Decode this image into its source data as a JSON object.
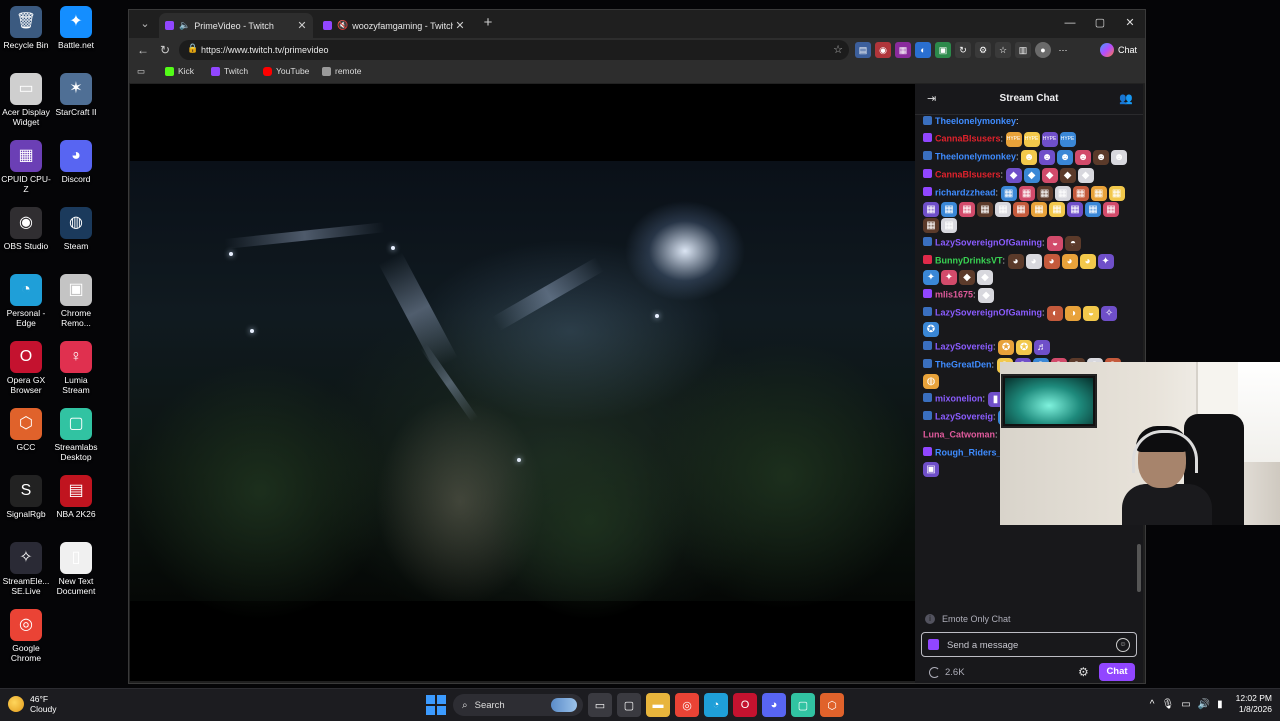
{
  "desktop": {
    "icons": [
      {
        "label": "Recycle Bin",
        "glyph": "🗑",
        "color": "#3b5a80"
      },
      {
        "label": "Battle.net",
        "glyph": "✦",
        "color": "#148eff"
      },
      {
        "label": "Acer Display Widget",
        "glyph": "▭",
        "color": "#cfcfcf"
      },
      {
        "label": "StarCraft II",
        "glyph": "✶",
        "color": "#4f6f95"
      },
      {
        "label": "CPUID CPU-Z",
        "glyph": "▦",
        "color": "#6b3fb5"
      },
      {
        "label": "Discord",
        "glyph": "◕",
        "color": "#5865f2"
      },
      {
        "label": "OBS Studio",
        "glyph": "◉",
        "color": "#302e31"
      },
      {
        "label": "Steam",
        "glyph": "◍",
        "color": "#1b3a5c"
      },
      {
        "label": "Personal - Edge",
        "glyph": "◔",
        "color": "#1f9fd8"
      },
      {
        "label": "Chrome Remo...",
        "glyph": "▣",
        "color": "#c4c4c4"
      },
      {
        "label": "Opera GX Browser",
        "glyph": "O",
        "color": "#c4122f"
      },
      {
        "label": "Lumia Stream",
        "glyph": "♀",
        "color": "#e0304f"
      },
      {
        "label": "GCC",
        "glyph": "⬡",
        "color": "#e0622b"
      },
      {
        "label": "Streamlabs Desktop",
        "glyph": "▢",
        "color": "#31c3a2"
      },
      {
        "label": "SignalRgb",
        "glyph": "S",
        "color": "#222"
      },
      {
        "label": "NBA 2K26",
        "glyph": "▤",
        "color": "#c0141f"
      },
      {
        "label": "StreamEle... SE.Live",
        "glyph": "✧",
        "color": "#2a2a35"
      },
      {
        "label": "New Text Document",
        "glyph": "▯",
        "color": "#f0f0f0"
      },
      {
        "label": "Google Chrome",
        "glyph": "◎",
        "color": "#ea4335"
      }
    ]
  },
  "browser": {
    "tabs": [
      {
        "title": "PrimeVideo - Twitch",
        "active": true
      },
      {
        "title": "woozyfamgaming - Twitch",
        "active": false
      }
    ],
    "url": "https://www.twitch.tv/primevideo",
    "copilot_label": "Chat",
    "favorites": [
      {
        "label": "Kick",
        "color": "#53fc18"
      },
      {
        "label": "Twitch",
        "color": "#9146ff"
      },
      {
        "label": "YouTube",
        "color": "#ff0000"
      },
      {
        "label": "remote",
        "color": "#9a9a9a"
      }
    ]
  },
  "chat": {
    "title": "Stream Chat",
    "messages": [
      {
        "user": "Theelonelymonkey",
        "color": "#3f8cff",
        "badge": "#3a6fbf",
        "emotes": []
      },
      {
        "user": "CannaBlsusers",
        "color": "#e0222c",
        "badge": "#9146ff",
        "emotes": [
          "HYPE",
          "HYPE",
          "HYPE",
          "HYPE"
        ]
      },
      {
        "user": "Theelonelymonkey",
        "color": "#3f8cff",
        "badge": "#3a6fbf",
        "emotes": [
          "☻",
          "☻",
          "☻",
          "☻",
          "☻",
          "☻"
        ]
      },
      {
        "user": "CannaBlsusers",
        "color": "#e0222c",
        "badge": "#9146ff",
        "emotes": [
          "◆",
          "◆",
          "◆",
          "◆",
          "◆"
        ]
      },
      {
        "user": "richardzzhead",
        "color": "#3f8cff",
        "badge": "#9146ff",
        "emotes": [
          "▦",
          "▦",
          "▦",
          "▦",
          "▦",
          "▦",
          "▦",
          "▦",
          "▦",
          "▦",
          "▦",
          "▦",
          "▦",
          "▦",
          "▦",
          "▦",
          "▦",
          "▦",
          "▦",
          "▦"
        ]
      },
      {
        "user": "LazySovereignOfGaming",
        "color": "#8a5cff",
        "badge": "#3a6fbf",
        "emotes": [
          "◒",
          "◓"
        ]
      },
      {
        "user": "BunnyDrinksVT",
        "color": "#39d353",
        "badge": "#e02a4a",
        "emotes": [
          "◕",
          "◕",
          "◕",
          "◕",
          "◕",
          "✦",
          "✦",
          "✦",
          "◆",
          "◆"
        ]
      },
      {
        "user": "mlis1675",
        "color": "#e05a9c",
        "badge": "#9146ff",
        "emotes": [
          "◆"
        ]
      },
      {
        "user": "LazySovereignOfGaming",
        "color": "#8a5cff",
        "badge": "#3a6fbf",
        "emotes": [
          "◐",
          "◑",
          "◒",
          "✧",
          "✪"
        ]
      },
      {
        "user": "LazySovereig",
        "color": "#8a5cff",
        "badge": "#3a6fbf",
        "emotes": [
          "✪",
          "✪",
          "♬"
        ]
      },
      {
        "user": "TheGreatDen",
        "color": "#3f8cff",
        "badge": "#3a6fbf",
        "emotes": [
          "◍",
          "◍",
          "◍",
          "◍",
          "◍",
          "◍",
          "◍",
          "◍"
        ]
      },
      {
        "user": "mixonelion",
        "color": "#8a5cff",
        "badge": "#3a6fbf",
        "emotes": [
          "▮"
        ]
      },
      {
        "user": "LazySovereig",
        "color": "#8a5cff",
        "badge": "#3a6fbf",
        "emotes": [
          "◐",
          "◑",
          "◒"
        ]
      },
      {
        "user": "Luna_Catwoman",
        "color": "#e05a9c",
        "badge": "",
        "emotes": [
          "☺",
          "☺",
          "☺",
          "☺",
          "☺",
          "☺",
          "☺"
        ]
      },
      {
        "user": "Rough_Riders_Gaming",
        "color": "#3f8cff",
        "badge": "#9146ff",
        "emotes": [
          "▣",
          "▣",
          "▣",
          "▣",
          "▣",
          "▣"
        ]
      }
    ],
    "emote_only_label": "Emote Only Chat",
    "input_placeholder": "Send a message",
    "points": "2.6K",
    "chat_button": "Chat"
  },
  "taskbar": {
    "weather_temp": "46°F",
    "weather_desc": "Cloudy",
    "search_label": "Search",
    "time": "12:02 PM",
    "date": "1/8/2026",
    "apps": [
      {
        "name": "file-explorer",
        "glyph": "▭",
        "color": "#3a3a40"
      },
      {
        "name": "task-view",
        "glyph": "▢",
        "color": "#3a3a40"
      },
      {
        "name": "folder",
        "glyph": "▬",
        "color": "#e8b53c"
      },
      {
        "name": "chrome",
        "glyph": "◎",
        "color": "#ea4335"
      },
      {
        "name": "edge",
        "glyph": "◔",
        "color": "#1f9fd8"
      },
      {
        "name": "opera-gx",
        "glyph": "O",
        "color": "#c4122f"
      },
      {
        "name": "discord",
        "glyph": "◕",
        "color": "#5865f2"
      },
      {
        "name": "streamlabs",
        "glyph": "▢",
        "color": "#31c3a2"
      },
      {
        "name": "gcc",
        "glyph": "⬡",
        "color": "#e0622b"
      }
    ]
  }
}
